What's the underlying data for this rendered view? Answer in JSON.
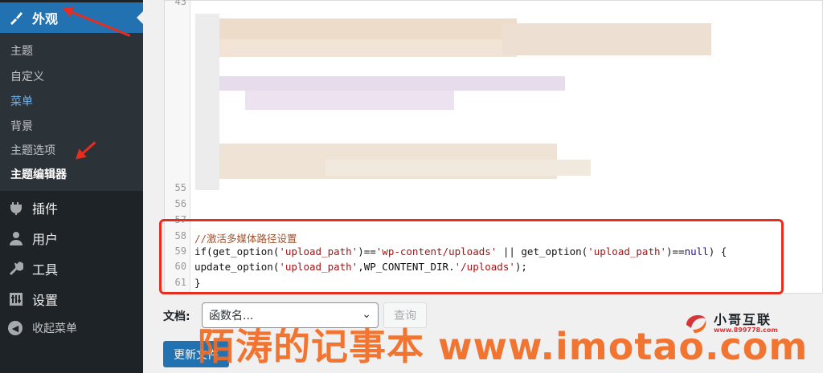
{
  "sidebar": {
    "appearance": {
      "label": "外观",
      "icon": "paintbrush-icon"
    },
    "submenu": [
      "主题",
      "自定义",
      "菜单",
      "背景",
      "主题选项",
      "主题编辑器"
    ],
    "plugins": {
      "label": "插件",
      "icon": "plugin-icon"
    },
    "users": {
      "label": "用户",
      "icon": "user-icon"
    },
    "tools": {
      "label": "工具",
      "icon": "wrench-icon"
    },
    "settings": {
      "label": "设置",
      "icon": "settings-icon"
    },
    "collapse": {
      "label": "收起菜单",
      "icon": "collapse-icon"
    }
  },
  "editor": {
    "line_numbers": [
      "43",
      "55",
      "56",
      "57",
      "58",
      "59",
      "60",
      "61"
    ],
    "code": {
      "l58": "//激活多媒体路径设置",
      "l59": {
        "p1": "if(get_option(",
        "s1": "'upload_path'",
        "p2": ")==",
        "s2": "'wp-content/uploads'",
        "p3": " || get_option(",
        "s3": "'upload_path'",
        "p4": ")==",
        "a1": "null",
        "p5": ") {"
      },
      "l60": {
        "p1": "update_option(",
        "s1": "'upload_path'",
        "p2": ",WP_CONTENT_DIR.",
        "s2": "'/uploads'",
        "p3": ");"
      },
      "l61": "}"
    }
  },
  "docs": {
    "label": "文档:",
    "select_value": "函数名...",
    "lookup_button": "查询"
  },
  "update_button": "更新文件",
  "watermark": {
    "text": "陌涛的记事本 www.imotao.com",
    "logo_brand": "小哥互联",
    "logo_domain": "www.899778.com"
  },
  "colors": {
    "sidebar_bg": "#1d2327",
    "active_bg": "#2271b1",
    "current_sub": "#72aee6",
    "annotation_red": "#e62d20",
    "watermark_orange": "#f26b21"
  }
}
